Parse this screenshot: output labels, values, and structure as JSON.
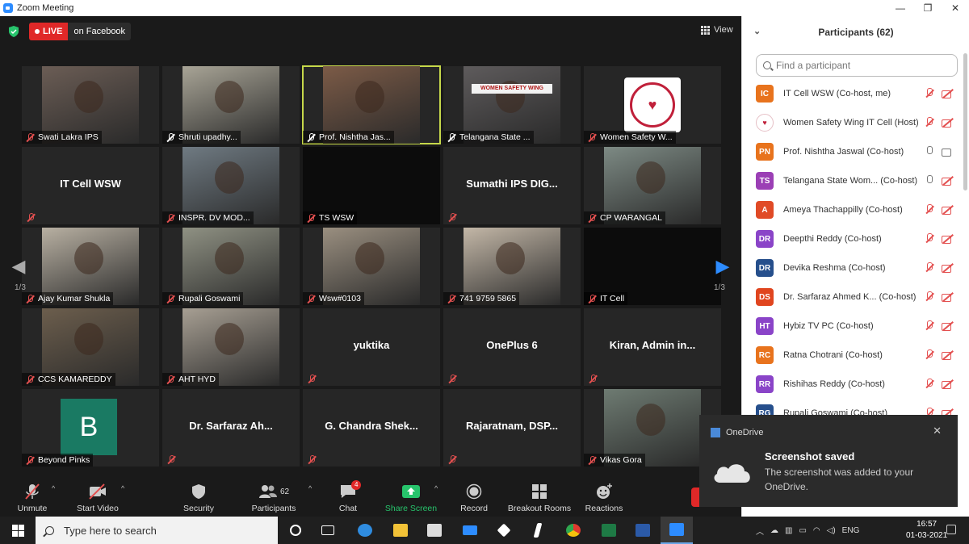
{
  "window": {
    "title": "Zoom Meeting",
    "controls": [
      "—",
      "❐",
      "✕"
    ]
  },
  "meeting": {
    "live_label": "LIVE",
    "live_target": "on Facebook",
    "view_label": "View",
    "page_left": "1/3",
    "page_right": "1/3"
  },
  "tiles": [
    {
      "name": "Swati Lakra IPS",
      "type": "video",
      "muted": true,
      "bg": "#6b5d55"
    },
    {
      "name": "Shruti upadhy...",
      "type": "video",
      "muted": false,
      "pinned": true,
      "bg": "#a8a496"
    },
    {
      "name": "Prof. Nishtha Jas...",
      "type": "video",
      "muted": false,
      "pinned": true,
      "bg": "#7c5b47",
      "active": true
    },
    {
      "name": "Telangana State ...",
      "type": "video",
      "muted": false,
      "pinned": true,
      "bg": "#5e5b5c",
      "banner": "WOMEN SAFETY WING"
    },
    {
      "name": "Women Safety W...",
      "type": "logo",
      "muted": true
    },
    {
      "name": "",
      "type": "text",
      "label": "IT Cell WSW",
      "muted": true
    },
    {
      "name": "INSPR. DV MOD...",
      "type": "video",
      "muted": true,
      "bg": "#6f7a82"
    },
    {
      "name": "TS WSW",
      "type": "black",
      "muted": true
    },
    {
      "name": "",
      "type": "text",
      "label": "Sumathi IPS DIG...",
      "muted": true
    },
    {
      "name": "CP WARANGAL",
      "type": "video",
      "muted": true,
      "bg": "#7d8a84"
    },
    {
      "name": "Ajay Kumar Shukla",
      "type": "video",
      "muted": true,
      "bg": "#b8b0a2"
    },
    {
      "name": "Rupali Goswami",
      "type": "video",
      "muted": true,
      "bg": "#8f9183"
    },
    {
      "name": "Wsw#0103",
      "type": "video",
      "muted": true,
      "bg": "#9a8f80"
    },
    {
      "name": "741 9759 5865",
      "type": "video",
      "muted": true,
      "bg": "#c3b7a7"
    },
    {
      "name": "IT Cell",
      "type": "black",
      "muted": true
    },
    {
      "name": "CCS KAMAREDDY",
      "type": "video",
      "muted": true,
      "bg": "#6c5e4d"
    },
    {
      "name": "AHT HYD",
      "type": "video",
      "muted": true,
      "bg": "#a79f93"
    },
    {
      "name": "",
      "type": "text",
      "label": "yuktika",
      "muted": true
    },
    {
      "name": "",
      "type": "text",
      "label": "OnePlus 6",
      "muted": true
    },
    {
      "name": "",
      "type": "text",
      "label": "Kiran, Admin in...",
      "muted": true
    },
    {
      "name": "Beyond Pinks",
      "type": "letter",
      "letter": "B",
      "muted": true
    },
    {
      "name": "",
      "type": "text",
      "label": "Dr. Sarfaraz Ah...",
      "muted": true
    },
    {
      "name": "",
      "type": "text",
      "label": "G. Chandra Shek...",
      "muted": true
    },
    {
      "name": "",
      "type": "text",
      "label": "Rajaratnam, DSP...",
      "muted": true
    },
    {
      "name": "Vikas Gora",
      "type": "video",
      "muted": true,
      "bg": "#6e7b72"
    }
  ],
  "toolbar": {
    "unmute": "Unmute",
    "start_video": "Start Video",
    "security": "Security",
    "participants": "Participants",
    "participants_count": "62",
    "chat": "Chat",
    "chat_badge": "4",
    "share_screen": "Share Screen",
    "record": "Record",
    "breakout": "Breakout Rooms",
    "reactions": "Reactions"
  },
  "panel": {
    "title": "Participants (62)",
    "search_placeholder": "Find a participant",
    "participants": [
      {
        "initials": "IC",
        "color": "#e8731d",
        "name": "IT Cell WSW (Co-host, me)",
        "mic": false,
        "cam": false
      },
      {
        "initials": "WS",
        "color": "logo",
        "name": "Women Safety Wing IT Cell (Host)",
        "mic": false,
        "cam": false
      },
      {
        "initials": "PN",
        "color": "#e8731d",
        "name": "Prof. Nishtha Jaswal (Co-host)",
        "mic": true,
        "cam": true
      },
      {
        "initials": "TS",
        "color": "#9b3fb5",
        "name": "Telangana State Wom... (Co-host)",
        "mic": true,
        "cam": false
      },
      {
        "initials": "A",
        "color": "#e04a26",
        "name": "Ameya Thachappilly (Co-host)",
        "mic": false,
        "cam": false
      },
      {
        "initials": "DR",
        "color": "#8a44c8",
        "name": "Deepthi Reddy (Co-host)",
        "mic": false,
        "cam": false
      },
      {
        "initials": "DR",
        "color": "#264f8c",
        "name": "Devika Reshma (Co-host)",
        "mic": false,
        "cam": false
      },
      {
        "initials": "DS",
        "color": "#e0451f",
        "name": "Dr. Sarfaraz Ahmed K... (Co-host)",
        "mic": false,
        "cam": false
      },
      {
        "initials": "HT",
        "color": "#8a44c8",
        "name": "Hybiz TV PC (Co-host)",
        "mic": false,
        "cam": false
      },
      {
        "initials": "RC",
        "color": "#e8731d",
        "name": "Ratna Chotrani (Co-host)",
        "mic": false,
        "cam": false
      },
      {
        "initials": "RR",
        "color": "#8a44c8",
        "name": "Rishihas Reddy (Co-host)",
        "mic": false,
        "cam": false
      },
      {
        "initials": "RG",
        "color": "#264f8c",
        "name": "Rupali Goswami (Co-host)",
        "mic": false,
        "cam": false
      }
    ]
  },
  "toast": {
    "app": "OneDrive",
    "title": "Screenshot saved",
    "body": "The screenshot was added to your OneDrive."
  },
  "taskbar": {
    "search_placeholder": "Type here to search",
    "lang": "ENG",
    "time": "16:57",
    "date": "01-03-2021"
  },
  "colors": {
    "live": "#e02828",
    "share": "#27c46c",
    "active_speaker": "#c6d84a",
    "muted": "#e35050"
  }
}
